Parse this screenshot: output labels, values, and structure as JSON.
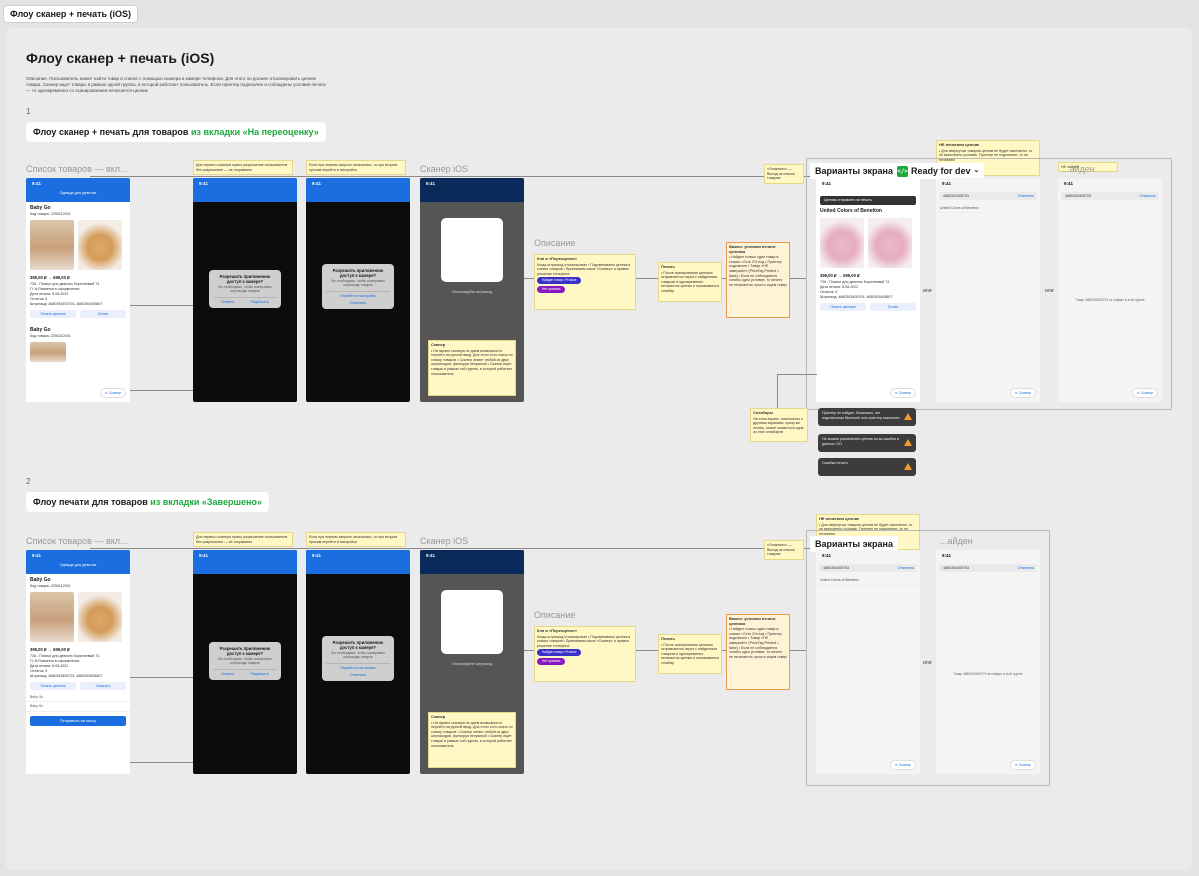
{
  "tab": "Флоу сканер + печать (iOS)",
  "board": {
    "title": "Флоу сканер + печать (iOS)",
    "description": "Описание. Пользователь может найти товар в списке с помощью сканера в камере телефона. Для этого он должен отсканировать ценник товара. Сканер ищет товары в рамках одной группы, в которой работает пользователь. Если принтер подключен и соблюдены условия печати — то одновременно со сканированием печатается ценник"
  },
  "section1": {
    "num": "1",
    "title_prefix": "Флоу сканер + печать для товаров ",
    "title_green": "из вкладки «На переоценку»"
  },
  "section2": {
    "num": "2",
    "title_prefix": "Флоу печати для товаров ",
    "title_green": "из вкладки «Завершено»"
  },
  "labels": {
    "product_list": "Список товаров — вкл...",
    "scanner_ios": "Сканер iOS",
    "description": "Описание",
    "variants": "Варианты экрана",
    "ready_for_dev": "Ready for dev",
    "not_found": "НЕ найден",
    "not_found_2": "...айден",
    "or": "или"
  },
  "phone": {
    "time": "9:41",
    "nav_title": "Одежда для девочек",
    "nav_sub": "Товары 6 из 6",
    "product_name": "Baby Go",
    "product_code": "Код товара: 2290212001",
    "price": "399,00 ₽ → 699,00 ₽",
    "desc": "736 - Платье для девочек Коричневый 74",
    "reason": "П: Ik Разметка в оформлении",
    "date": "Дата печати: 8.08.2022",
    "stock": "Остаток: 5",
    "barcode": "Штрихкод: 4680393405703, 4680393405807",
    "btn_print": "Печать ценника",
    "btn_done": "Готово",
    "btn_revert": "Свернуть",
    "btn_scanner": "Сканер",
    "btn_send": "Отправить на кассу",
    "brand": "United Colors of Benetton",
    "toast_print": "Ценник отправлен на печать"
  },
  "camera_dialog1": {
    "title": "Разрешить приложению доступ к камере?",
    "desc": "Это необходимо, чтобы сканировать штрихкоды товаров",
    "cancel": "Отмена",
    "allow": "Разрешить"
  },
  "camera_dialog2": {
    "title": "Разрешить приложению доступ к камере?",
    "desc": "Это необходимо, чтобы сканировать штрихкоды товаров",
    "settings": "Перейти в настройки",
    "cancel": "Отменить"
  },
  "scanner": {
    "hint": "Отсканируйте штрихкод"
  },
  "notes": {
    "permission1": "Для первого сканера нужно разрешение пользователя без разрешения — не открываем",
    "permission2": "Если при первом запросе отказались, то при втором просим перейти в настройки",
    "scanner_title": "Сканер",
    "scanner_body": "• На экране сканера не даем возможности перейти на ручной ввод. Для этого есть поиск по списку товаров • Сканер читает любой из двух штрихкодов, фильтруя ненужный • Сканер ищет товары в рамках той группы, в которой работает пользователь",
    "reprice_title": "Кнп в «Переоценке»",
    "reprice_body": "Когда штрихкод отсканирован • Подсвечиваем ценник в списке товаров • Принимаем какое «Сканер» и прямое решение телефона",
    "print_title": "Печать",
    "print_body": "• После сканирования ценника отправляется через с найденным товаром и одновременно печатается ценник и показывается снэкбар",
    "conditions_title": "Важно: условия печати ценника",
    "conditions_body": "• Найден только один товар в списке • Есть 2% под • Принтер подключен • Товар «НЕ завершён» (PriceTag Printed = false) • Если не соблюдается хотябы одно условие, то ничего не печатается, просто ищем товар",
    "close_note": "«Отменить» — Выход из списка товаров",
    "not_printed_title": "НЕ печатаем ценник",
    "not_printed_body": "• Для свернутых товаров ценник не будет напечатан, то не выполнено условие. Принтер не подключен, то не печатаем",
    "snackbar_title": "Снэкбары",
    "snackbar_body": "На этом экране, аналогично с другими экранами, сразу же печать, может появиться одна из этих снэкбаров"
  },
  "chips": {
    "chip1": "Найден товар • Product",
    "chip2": "Нет ценника"
  },
  "toasts": {
    "t1": "Принтер не найден. Возможно, нет подключения Bluetooth или принтер выключен",
    "t2": "Не можем распечатать ценник из-за ошибки в данных CAT",
    "t3": "Ошибка печати"
  },
  "search": {
    "query": "4680393405703",
    "cancel": "Отменить",
    "empty": "Товар 4680393405703 не найден в этой группе"
  }
}
